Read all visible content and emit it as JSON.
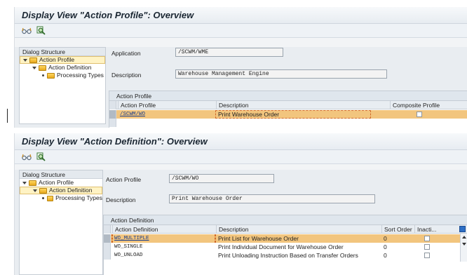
{
  "colors": {
    "selection": "#f2c57e",
    "folder": "#e8a91c",
    "link": "#1a3e8c"
  },
  "screen1": {
    "title": "Display View \"Action Profile\": Overview",
    "toolbar": [
      {
        "icon": "glasses-icon"
      },
      {
        "icon": "find-icon"
      }
    ],
    "tree": {
      "header": "Dialog Structure",
      "items": [
        {
          "label": "Action Profile",
          "level": 0,
          "expanded": true,
          "selected": true
        },
        {
          "label": "Action Definition",
          "level": 1,
          "expanded": true,
          "selected": false
        },
        {
          "label": "Processing Types",
          "level": 2,
          "expanded": false,
          "selected": false
        }
      ]
    },
    "form": {
      "application_label": "Application",
      "application_value": "/SCWM/WME",
      "description_label": "Description",
      "description_value": "Warehouse Management Engine"
    },
    "table": {
      "title": "Action Profile",
      "columns": [
        "Action Profile",
        "Description",
        "Composite Profile"
      ],
      "rows": [
        {
          "profile": "/SCWM/WO",
          "description": "Print Warehouse Order",
          "composite": false,
          "selected": true
        }
      ]
    }
  },
  "screen2": {
    "title": "Display View \"Action Definition\": Overview",
    "toolbar": [
      {
        "icon": "glasses-icon"
      },
      {
        "icon": "find-icon"
      }
    ],
    "tree": {
      "header": "Dialog Structure",
      "items": [
        {
          "label": "Action Profile",
          "level": 0,
          "expanded": true,
          "selected": false
        },
        {
          "label": "Action Definition",
          "level": 1,
          "expanded": true,
          "selected": true
        },
        {
          "label": "Processing Types",
          "level": 2,
          "expanded": false,
          "selected": false
        }
      ]
    },
    "form": {
      "profile_label": "Action Profile",
      "profile_value": "/SCWM/WO",
      "description_label": "Description",
      "description_value": "Print Warehouse Order"
    },
    "table": {
      "title": "Action Definition",
      "columns": [
        "Action Definition",
        "Description",
        "Sort Order",
        "Inacti..."
      ],
      "rows": [
        {
          "definition": "WO_MULTIPLE",
          "description": "Print List for Warehouse Order",
          "sort": "0",
          "inactive": false,
          "selected": true
        },
        {
          "definition": "WO_SINGLE",
          "description": "Print Individual Document for Warehouse Order",
          "sort": "0",
          "inactive": false,
          "selected": false
        },
        {
          "definition": "WO_UNLOAD",
          "description": "Print Unloading Instruction Based on Transfer Orders",
          "sort": "0",
          "inactive": false,
          "selected": false
        }
      ]
    }
  }
}
